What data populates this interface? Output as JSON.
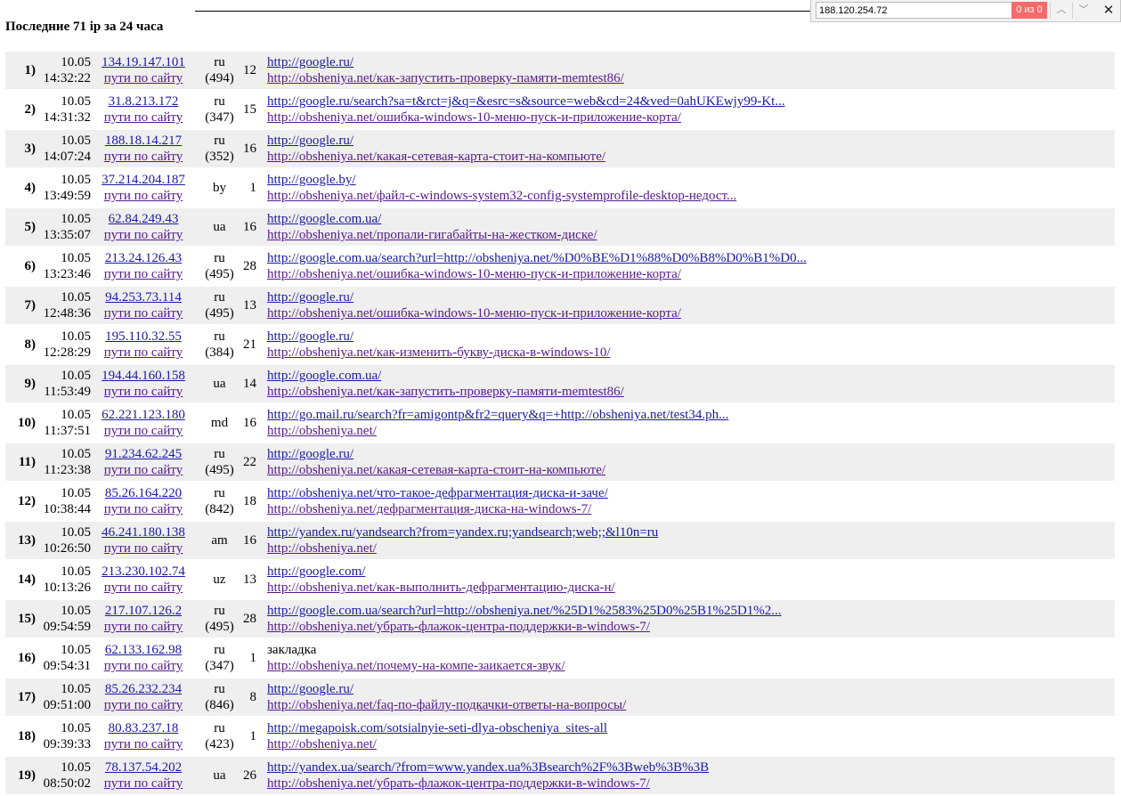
{
  "title": "Последние 71 ip за 24 часа",
  "findbar": {
    "query": "188.120.254.72",
    "count": "0 из 0",
    "up_icon": "chevron-up-icon",
    "down_icon": "chevron-down-icon",
    "close_icon": "close-icon",
    "up_glyph": "︿",
    "down_glyph": "﹀",
    "close_glyph": "✕"
  },
  "rows": [
    {
      "n": "1)",
      "date": "10.05",
      "time": "14:32:22",
      "ip": "134.19.147.101",
      "path": "пути по сайту",
      "cc": "ru",
      "reg": "(494)",
      "views": "12",
      "ref": "http://google.ru/",
      "page": "http://obsheniya.net/как-запустить-проверку-памяти-memtest86/"
    },
    {
      "n": "2)",
      "date": "10.05",
      "time": "14:31:32",
      "ip": "31.8.213.172",
      "path": "пути по сайту",
      "cc": "ru",
      "reg": "(347)",
      "views": "15",
      "ref": "http://google.ru/search?sa=t&rct=j&q=&esrc=s&source=web&cd=24&ved=0ahUKEwjy99-Kt...",
      "page": "http://obsheniya.net/ошибка-windows-10-меню-пуск-и-приложение-корта/"
    },
    {
      "n": "3)",
      "date": "10.05",
      "time": "14:07:24",
      "ip": "188.18.14.217",
      "path": "пути по сайту",
      "cc": "ru",
      "reg": "(352)",
      "views": "16",
      "ref": "http://google.ru/",
      "page": "http://obsheniya.net/какая-сетевая-карта-стоит-на-компьюте/"
    },
    {
      "n": "4)",
      "date": "10.05",
      "time": "13:49:59",
      "ip": "37.214.204.187",
      "path": "пути по сайту",
      "cc": "by",
      "reg": "",
      "views": "1",
      "ref": "http://google.by/",
      "page": "http://obsheniya.net/файл-c-windows-system32-config-systemprofile-desktop-недост..."
    },
    {
      "n": "5)",
      "date": "10.05",
      "time": "13:35:07",
      "ip": "62.84.249.43",
      "path": "пути по сайту",
      "cc": "ua",
      "reg": "",
      "views": "16",
      "ref": "http://google.com.ua/",
      "page": "http://obsheniya.net/пропали-гигабайты-на-жестком-диске/"
    },
    {
      "n": "6)",
      "date": "10.05",
      "time": "13:23:46",
      "ip": "213.24.126.43",
      "path": "пути по сайту",
      "cc": "ru",
      "reg": "(495)",
      "views": "28",
      "ref": "http://google.com.ua/search?url=http://obsheniya.net/%D0%BE%D1%88%D0%B8%D0%B1%D0...",
      "page": "http://obsheniya.net/ошибка-windows-10-меню-пуск-и-приложение-корта/"
    },
    {
      "n": "7)",
      "date": "10.05",
      "time": "12:48:36",
      "ip": "94.253.73.114",
      "path": "пути по сайту",
      "cc": "ru",
      "reg": "(495)",
      "views": "13",
      "ref": "http://google.ru/",
      "page": "http://obsheniya.net/ошибка-windows-10-меню-пуск-и-приложение-корта/"
    },
    {
      "n": "8)",
      "date": "10.05",
      "time": "12:28:29",
      "ip": "195.110.32.55",
      "path": "пути по сайту",
      "cc": "ru",
      "reg": "(384)",
      "views": "21",
      "ref": "http://google.ru/",
      "page": "http://obsheniya.net/как-изменить-букву-диска-в-windows-10/"
    },
    {
      "n": "9)",
      "date": "10.05",
      "time": "11:53:49",
      "ip": "194.44.160.158",
      "path": "пути по сайту",
      "cc": "ua",
      "reg": "",
      "views": "14",
      "ref": "http://google.com.ua/",
      "page": "http://obsheniya.net/как-запустить-проверку-памяти-memtest86/"
    },
    {
      "n": "10)",
      "date": "10.05",
      "time": "11:37:51",
      "ip": "62.221.123.180",
      "path": "пути по сайту",
      "cc": "md",
      "reg": "",
      "views": "16",
      "ref": "http://go.mail.ru/search?fr=amigontp&fr2=query&q=+http://obsheniya.net/test34.ph...",
      "page": "http://obsheniya.net/"
    },
    {
      "n": "11)",
      "date": "10.05",
      "time": "11:23:38",
      "ip": "91.234.62.245",
      "path": "пути по сайту",
      "cc": "ru",
      "reg": "(495)",
      "views": "22",
      "ref": "http://google.ru/",
      "page": "http://obsheniya.net/какая-сетевая-карта-стоит-на-компьюте/"
    },
    {
      "n": "12)",
      "date": "10.05",
      "time": "10:38:44",
      "ip": "85.26.164.220",
      "path": "пути по сайту",
      "cc": "ru",
      "reg": "(842)",
      "views": "18",
      "ref": "http://obsheniya.net/что-такое-дефрагментация-диска-и-заче/",
      "page": "http://obsheniya.net/дефрагментация-диска-на-windows-7/"
    },
    {
      "n": "13)",
      "date": "10.05",
      "time": "10:26:50",
      "ip": "46.241.180.138",
      "path": "пути по сайту",
      "cc": "am",
      "reg": "",
      "views": "16",
      "ref": "http://yandex.ru/yandsearch?from=yandex.ru;yandsearch;web;;&l10n=ru",
      "page": "http://obsheniya.net/"
    },
    {
      "n": "14)",
      "date": "10.05",
      "time": "10:13:26",
      "ip": "213.230.102.74",
      "path": "пути по сайту",
      "cc": "uz",
      "reg": "",
      "views": "13",
      "ref": "http://google.com/",
      "page": "http://obsheniya.net/как-выполнить-дефрагментацию-диска-н/"
    },
    {
      "n": "15)",
      "date": "10.05",
      "time": "09:54:59",
      "ip": "217.107.126.2",
      "path": "пути по сайту",
      "cc": "ru",
      "reg": "(495)",
      "views": "28",
      "ref": "http://google.com.ua/search?url=http://obsheniya.net/%25D1%2583%25D0%25B1%25D1%2...",
      "page": "http://obsheniya.net/убрать-флажок-центра-поддержки-в-windows-7/"
    },
    {
      "n": "16)",
      "date": "10.05",
      "time": "09:54:31",
      "ip": "62.133.162.98",
      "path": "пути по сайту",
      "cc": "ru",
      "reg": "(347)",
      "views": "1",
      "ref": "закладка",
      "ref_plain": true,
      "page": "http://obsheniya.net/почему-на-компе-заикается-звук/"
    },
    {
      "n": "17)",
      "date": "10.05",
      "time": "09:51:00",
      "ip": "85.26.232.234",
      "path": "пути по сайту",
      "cc": "ru",
      "reg": "(846)",
      "views": "8",
      "ref": "http://google.ru/",
      "page": "http://obsheniya.net/faq-по-файлу-подкачки-ответы-на-вопросы/"
    },
    {
      "n": "18)",
      "date": "10.05",
      "time": "09:39:33",
      "ip": "80.83.237.18",
      "path": "пути по сайту",
      "cc": "ru",
      "reg": "(423)",
      "views": "1",
      "ref": "http://megapoisk.com/sotsialnyie-seti-dlya-obscheniya_sites-all",
      "page": "http://obsheniya.net/"
    },
    {
      "n": "19)",
      "date": "10.05",
      "time": "08:50:02",
      "ip": "78.137.54.202",
      "path": "пути по сайту",
      "cc": "ua",
      "reg": "",
      "views": "26",
      "ref": "http://yandex.ua/search/?from=www.yandex.ua%3Bsearch%2F%3Bweb%3B%3B",
      "page": "http://obsheniya.net/убрать-флажок-центра-поддержки-в-windows-7/"
    }
  ]
}
